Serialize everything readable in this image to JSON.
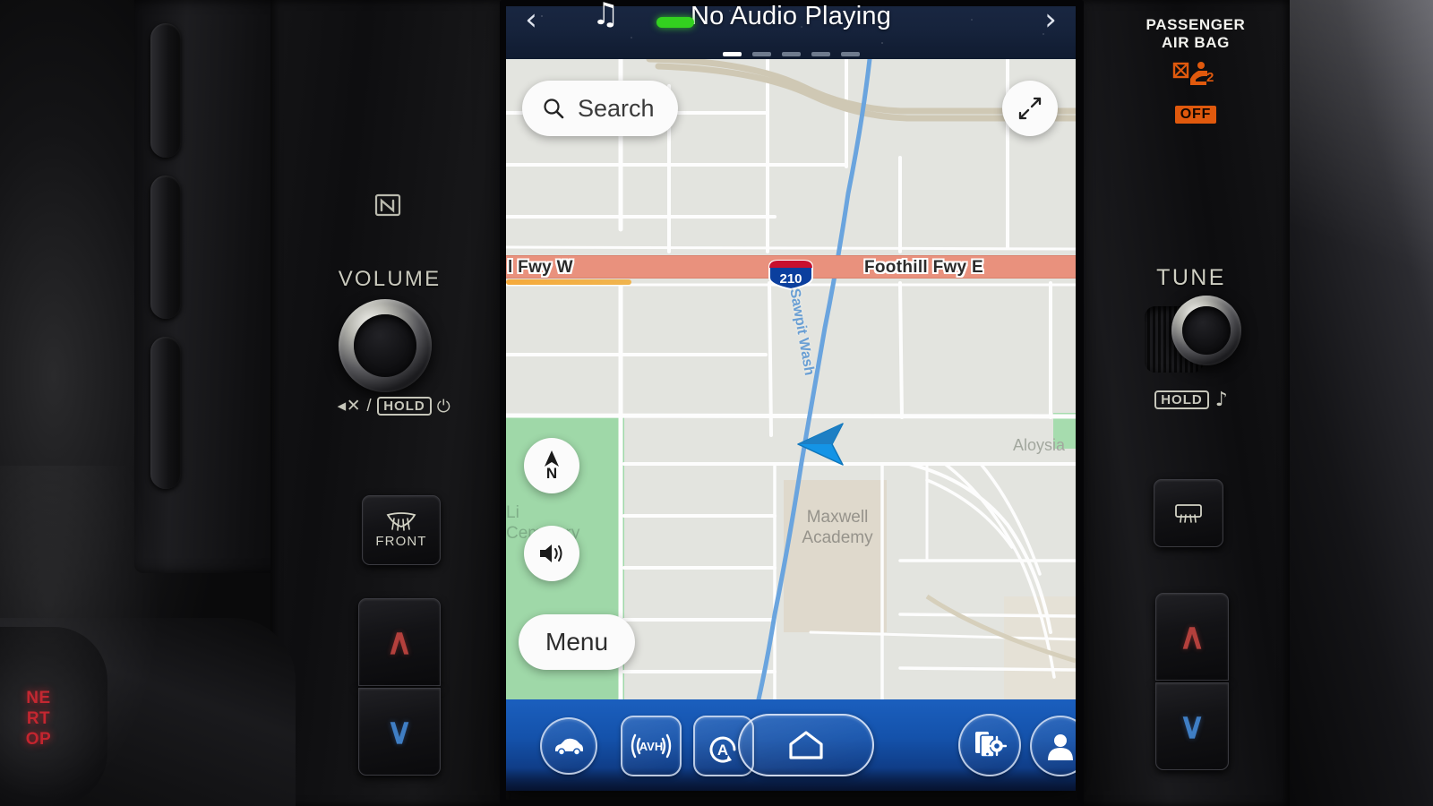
{
  "head_unit": {
    "status_bar": {
      "media_title": "No Audio Playing",
      "prev_label": "‹",
      "next_label": "›",
      "note_icon": "♫",
      "page_dots": 5,
      "active_dot": 0
    },
    "map": {
      "search_placeholder": "Search",
      "menu_label": "Menu",
      "compass_label": "N",
      "freeway": {
        "shield_number": "210",
        "label_west": "l Fwy W",
        "label_east": "Foothill Fwy E"
      },
      "labels": {
        "creek": "Sawpit Wash",
        "school": "Maxwell\nAcademy",
        "cemetery": "Li\nCemetery",
        "aloysia": "Aloysia"
      },
      "colors": {
        "land": "#e3e4df",
        "park_green": "#9fd8a8",
        "freeway": "#e9917d",
        "water": "#6aa4de",
        "marker_blue": "#1494e6",
        "ramp_orange": "#f5a93a"
      }
    },
    "bottom_bar": {
      "items": [
        {
          "name": "vehicle",
          "icon": "car-icon",
          "shape": "circle"
        },
        {
          "name": "avh",
          "icon": "avh-icon",
          "shape": "square",
          "label": "AVH"
        },
        {
          "name": "auto-start-stop",
          "icon": "auto-stop-icon",
          "shape": "square",
          "led": "#33d11f"
        },
        {
          "name": "home",
          "icon": "home-icon",
          "shape": "pill"
        },
        {
          "name": "phone-settings",
          "icon": "phone-settings-icon",
          "shape": "circle"
        },
        {
          "name": "profile",
          "icon": "user-icon",
          "shape": "circle"
        }
      ]
    }
  },
  "console": {
    "left": {
      "nfc_icon": "nfc-icon",
      "volume_label": "VOLUME",
      "volume_sub": {
        "mute": "◂✕",
        "sep": "/",
        "hold": "HOLD",
        "power": "⏻"
      },
      "defrost_front_label": "FRONT",
      "temp_up": "∧",
      "temp_down": "∨"
    },
    "right": {
      "tune_label": "TUNE",
      "tune_sub": {
        "hold": "HOLD",
        "note": "♪"
      },
      "temp_up": "∧",
      "temp_down": "∨"
    },
    "airbag": {
      "line1": "PASSENGER",
      "line2": "AIR BAG",
      "status": "OFF",
      "color": "#e0590d"
    },
    "ignition": {
      "line1": "NE",
      "line2": "RT",
      "line3": "OP",
      "color": "#c2202a"
    }
  }
}
